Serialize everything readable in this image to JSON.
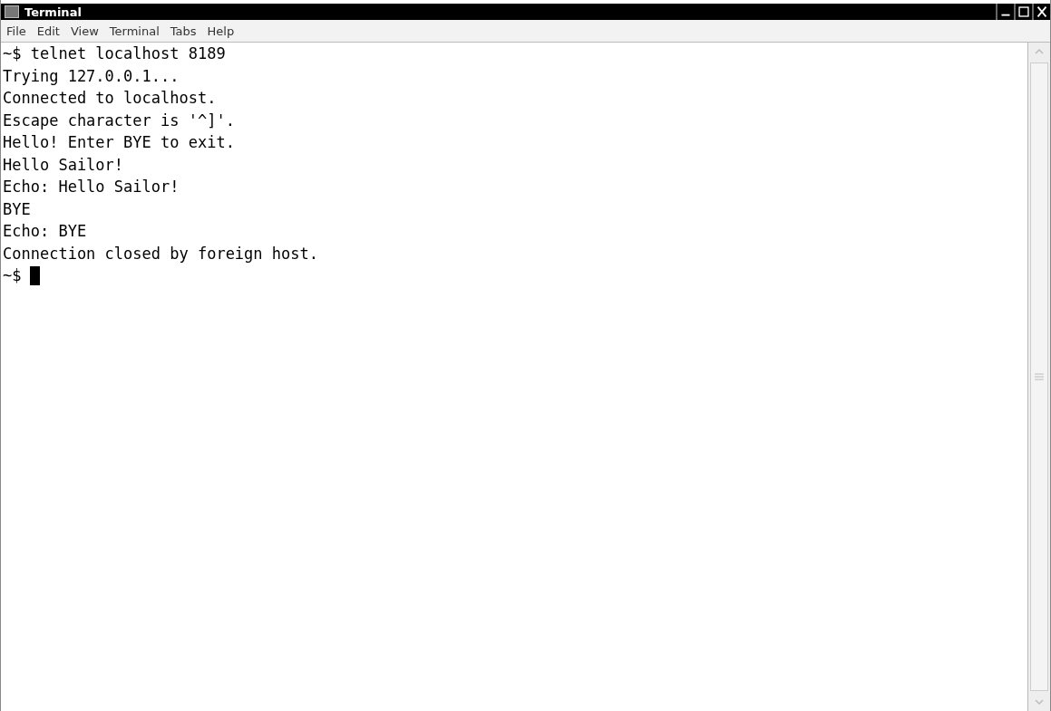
{
  "window": {
    "title": "Terminal"
  },
  "menu": [
    "File",
    "Edit",
    "View",
    "Terminal",
    "Tabs",
    "Help"
  ],
  "terminal": {
    "lines": [
      "~$ telnet localhost 8189",
      "Trying 127.0.0.1...",
      "Connected to localhost.",
      "Escape character is '^]'.",
      "Hello! Enter BYE to exit.",
      "Hello Sailor!",
      "Echo: Hello Sailor!",
      "BYE",
      "Echo: BYE",
      "Connection closed by foreign host."
    ],
    "prompt": "~$"
  }
}
